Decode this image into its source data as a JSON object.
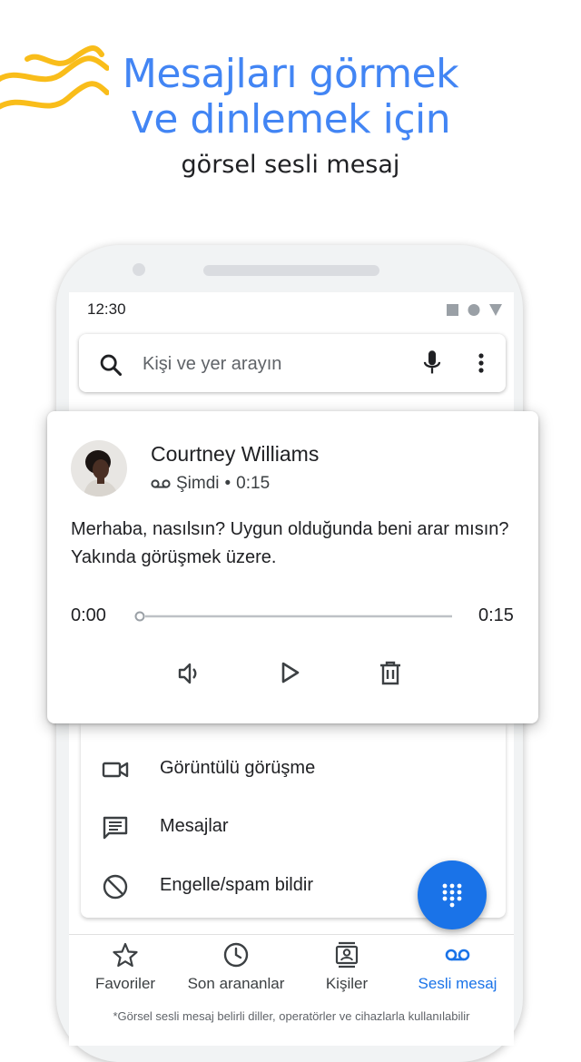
{
  "header": {
    "title_line1": "Mesajları görmek",
    "title_line2": "ve dinlemek için",
    "subtitle": "görsel sesli mesaj"
  },
  "status_bar": {
    "time": "12:30"
  },
  "search": {
    "placeholder": "Kişi ve yer arayın",
    "icons": [
      "search-icon",
      "mic-icon",
      "more-vert-icon"
    ]
  },
  "voicemail": {
    "caller": "Courtney Williams",
    "when": "Şimdi",
    "separator": "•",
    "duration": "0:15",
    "transcript": "Merhaba, nasılsın? Uygun olduğunda beni arar mısın? Yakında görüşmek üzere.",
    "position": "0:00",
    "length": "0:15",
    "progress": 0,
    "controls": [
      "speaker-icon",
      "play-icon",
      "delete-icon"
    ]
  },
  "actions": [
    {
      "label": "Görüntülü görüşme",
      "icon": "video-call-icon"
    },
    {
      "label": "Mesajlar",
      "icon": "message-icon"
    },
    {
      "label": "Engelle/spam bildir",
      "icon": "block-icon"
    }
  ],
  "fab": {
    "icon": "dialpad-icon"
  },
  "bottom_nav": [
    {
      "label": "Favoriler",
      "icon": "star-icon",
      "active": false
    },
    {
      "label": "Son arananlar",
      "icon": "clock-icon",
      "active": false
    },
    {
      "label": "Kişiler",
      "icon": "contacts-icon",
      "active": false
    },
    {
      "label": "Sesli mesaj",
      "icon": "voicemail-icon",
      "active": true
    }
  ],
  "footnote": "*Görsel sesli mesaj belirli diller, operatörler ve cihazlarla kullanılabilir",
  "colors": {
    "accent": "#4285f4",
    "active_blue": "#1a73e8",
    "wave_yellow": "#f9bd1a"
  }
}
